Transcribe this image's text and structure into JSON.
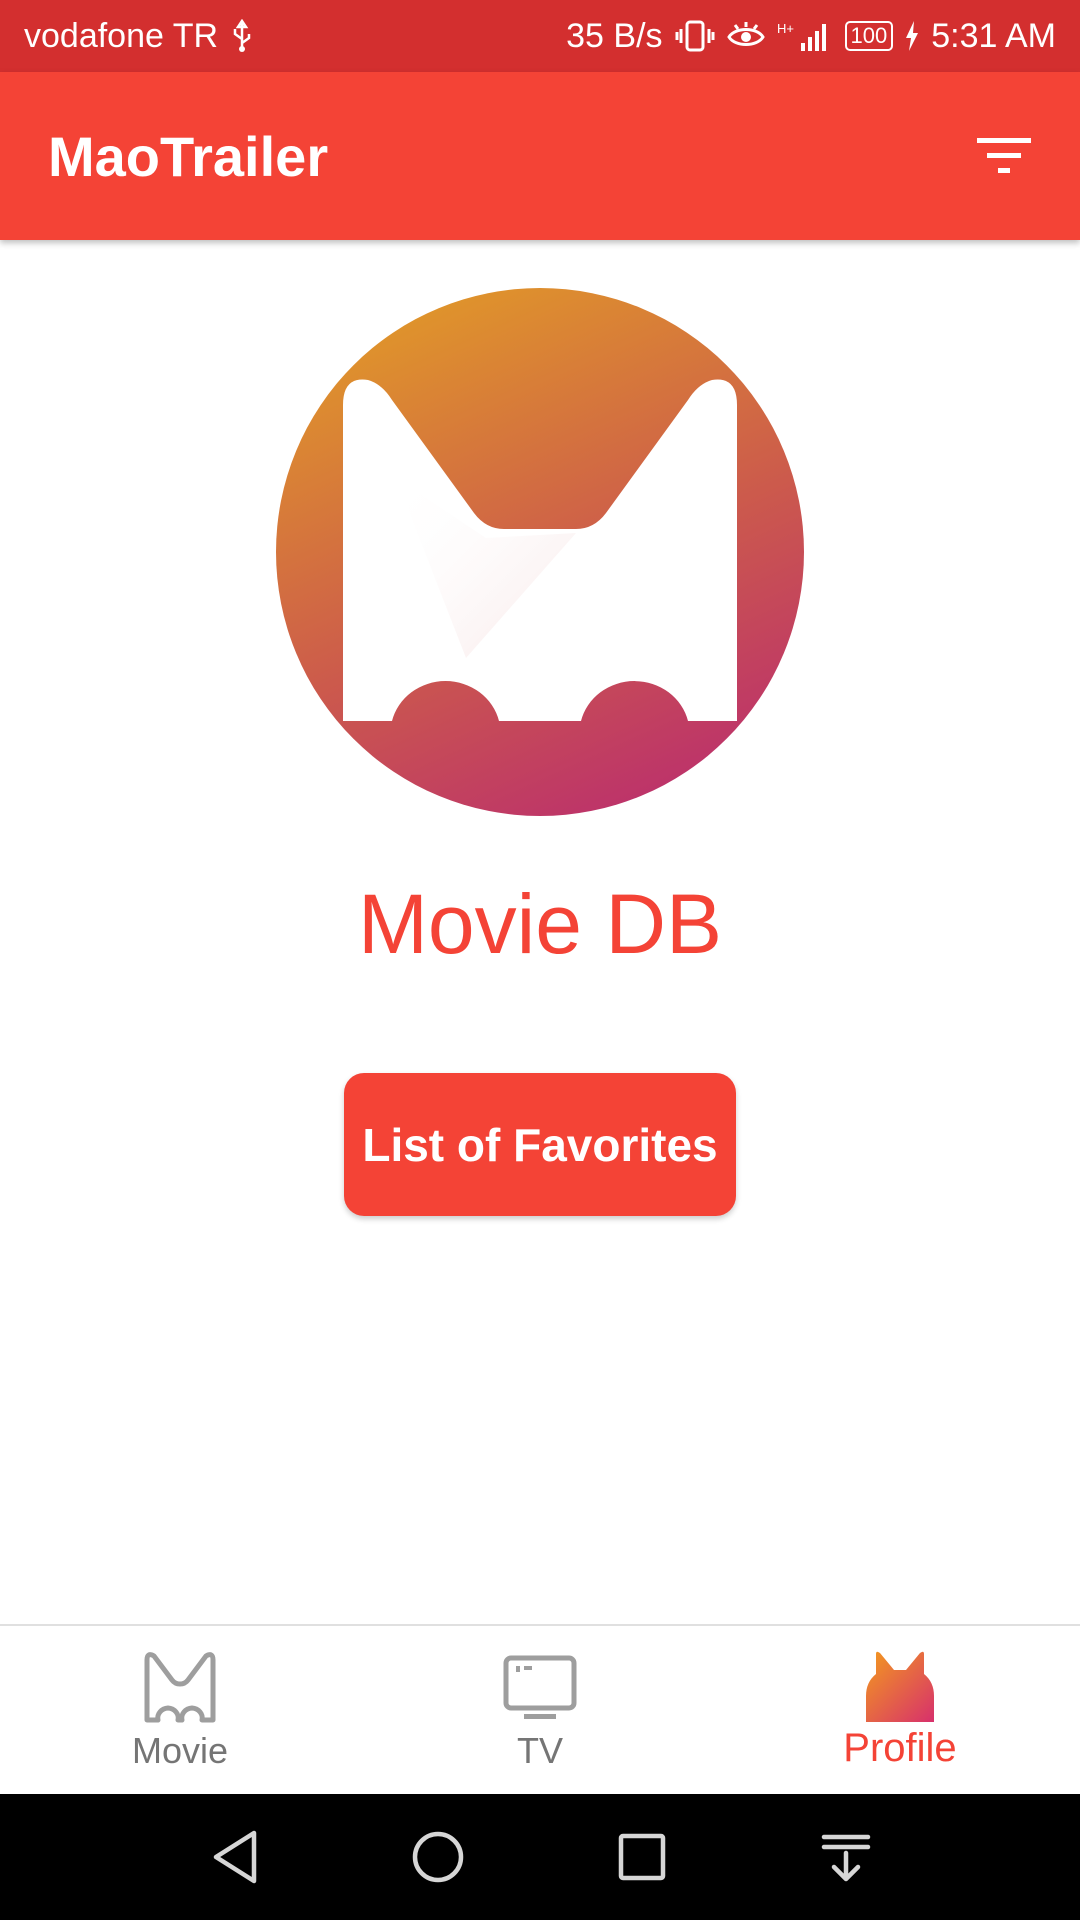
{
  "status_bar": {
    "carrier": "vodafone TR",
    "net_speed": "35 B/s",
    "network_type": "H+",
    "battery": "100",
    "time": "5:31 AM",
    "icons": [
      "usb-icon",
      "vibrate-icon",
      "eye-comfort-icon",
      "signal-icon",
      "battery-icon",
      "charging-icon"
    ]
  },
  "app_bar": {
    "title": "MaoTrailer",
    "action_icon": "filter-icon"
  },
  "profile": {
    "logo_icon": "maotrailer-logo-icon",
    "name": "Movie DB",
    "favorites_button": "List of Favorites"
  },
  "bottom_nav": {
    "items": [
      {
        "label": "Movie",
        "icon": "movie-icon",
        "active": false
      },
      {
        "label": "TV",
        "icon": "tv-icon",
        "active": false
      },
      {
        "label": "Profile",
        "icon": "profile-cat-icon",
        "active": true
      }
    ]
  },
  "system_nav": [
    "back-icon",
    "home-icon",
    "recents-icon",
    "notification-pull-icon"
  ],
  "colors": {
    "status_bar": "#d32f2f",
    "primary": "#f44336",
    "gradient_start": "#e0962a",
    "gradient_end": "#bb2f6d",
    "inactive": "#757575"
  }
}
